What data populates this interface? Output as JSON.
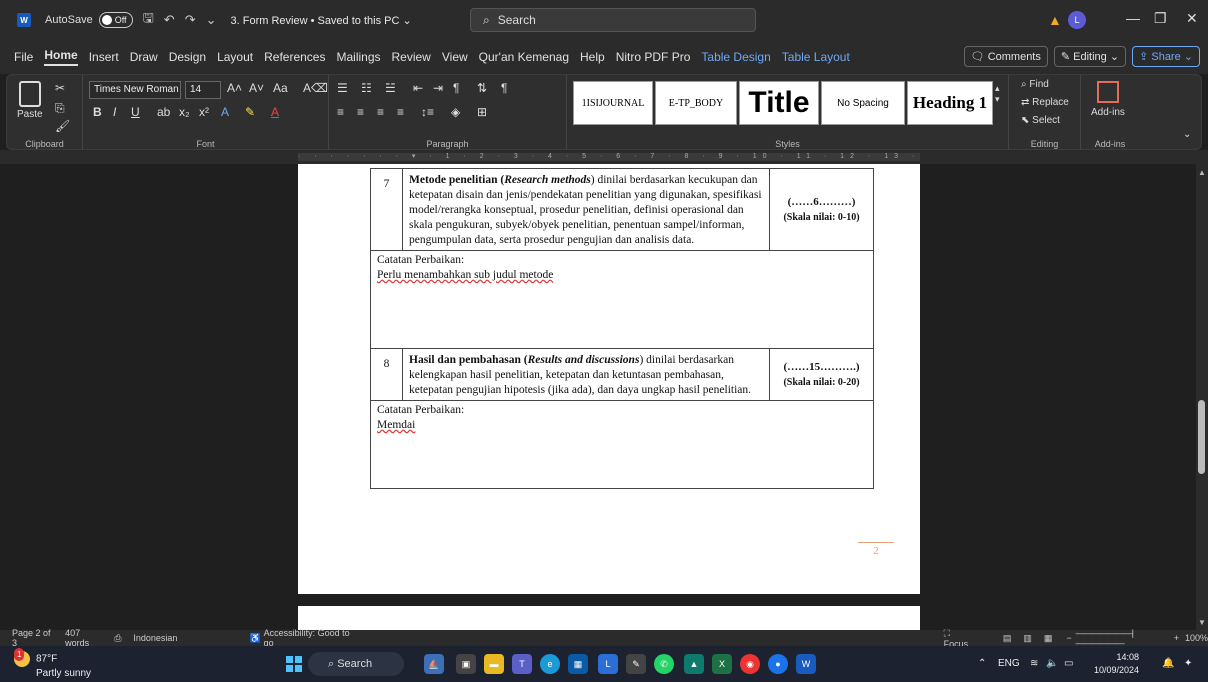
{
  "titlebar": {
    "app_logo": "W",
    "autosave_label": "AutoSave",
    "autosave_state": "Off",
    "doc_title": "3. Form Review • Saved to this PC ⌄",
    "search_placeholder": "Search",
    "avatar": "L"
  },
  "menu": {
    "tabs": [
      "File",
      "Home",
      "Insert",
      "Draw",
      "Design",
      "Layout",
      "References",
      "Mailings",
      "Review",
      "View",
      "Qur'an Kemenag",
      "Help",
      "Nitro PDF Pro",
      "Table Design",
      "Table Layout"
    ],
    "active": "Home",
    "comments": "Comments",
    "editing": "Editing",
    "share": "Share"
  },
  "ribbon": {
    "clipboard": {
      "label": "Clipboard",
      "paste": "Paste"
    },
    "font": {
      "label": "Font",
      "name": "Times New Roman",
      "size": "14"
    },
    "paragraph": {
      "label": "Paragraph"
    },
    "styles": {
      "label": "Styles",
      "items": [
        "1ISIJOURNAL",
        "E-TP_BODY",
        "Title",
        "No Spacing",
        "Heading 1"
      ]
    },
    "editing": {
      "label": "Editing",
      "find": "Find",
      "replace": "Replace",
      "select": "Select"
    },
    "addins": {
      "label": "Add-ins",
      "btn": "Add-ins"
    }
  },
  "document": {
    "rows": [
      {
        "num": "7",
        "title": "Metode penelitian",
        "title_en": "Research methods",
        "desc_rest": ") dinilai berdasarkan kecukupan dan ketepatan disain dan jenis/pendekatan penelitian yang digunakan, spesifikasi model/rerangka konseptual, prosedur penelitian, definisi operasional dan skala pengukuran, subyek/obyek penelitian, penentuan sampel/informan, pengumpulan data, serta prosedur pengujian dan analisis data.",
        "score": "(……6………)",
        "scale": "(Skala nilai: 0-10)",
        "note_label": "Catatan Perbaikan:",
        "note": "Perlu menambahkan sub judul metode"
      },
      {
        "num": "8",
        "title": "Hasil dan pembahasan",
        "title_en": "Results and discussions",
        "desc_rest": ") dinilai berdasarkan kelengkapan hasil penelitian, ketepatan dan ketuntasan pembahasan, ketepatan pengujian hipotesis (jika ada), dan daya ungkap hasil penelitian.",
        "score": "(……15……….)",
        "scale": "(Skala nilai: 0-20)",
        "note_label": "Catatan Perbaikan:",
        "note": "Memdai"
      }
    ],
    "page_number": "2"
  },
  "status": {
    "page": "Page 2 of 3",
    "words": "407 words",
    "language": "Indonesian",
    "accessibility": "Accessibility: Good to go",
    "focus": "Focus",
    "zoom": "100%"
  },
  "taskbar": {
    "temp": "87°F",
    "weather": "Partly sunny",
    "weather_badge": "1",
    "search": "Search",
    "lang": "ENG",
    "time": "14:08",
    "date": "10/09/2024"
  }
}
